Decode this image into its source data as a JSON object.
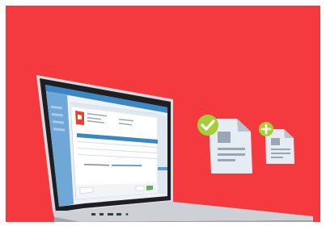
{
  "colors": {
    "background": "#f43a3e",
    "check_badge": "#a6cf37",
    "plus_badge": "#a6cf37",
    "document_paper": "#e6ecf3",
    "document_shadow": "#b9c3cf",
    "laptop_body": "#cfd3d8",
    "laptop_bezel": "#1d1f22",
    "app_window_header": "#3b87c6",
    "app_accent_green": "#5fb15e",
    "app_pdf_red": "#e0452f"
  },
  "icons": {
    "check": "check-icon",
    "plus": "plus-icon",
    "document": "document-icon",
    "pdf": "pdf-file-icon"
  }
}
